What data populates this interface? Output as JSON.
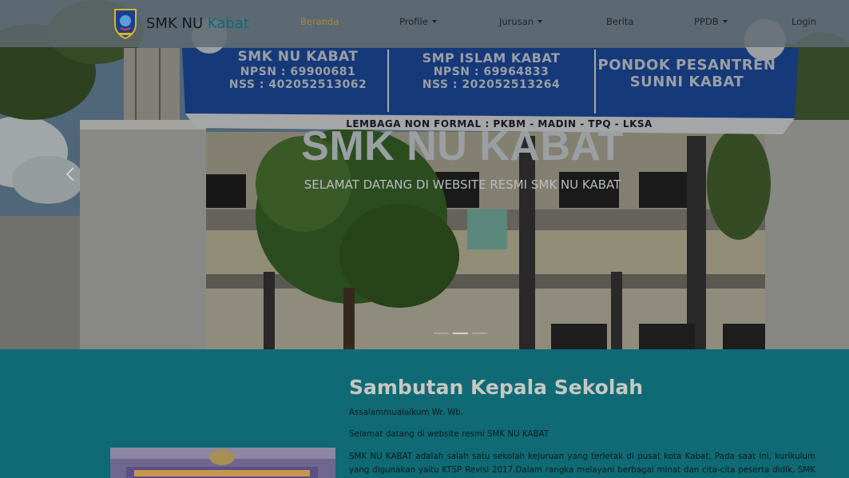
{
  "navbar": {
    "brand": {
      "name_main": "SMK NU",
      "name_accent": "Kabat",
      "logo": "school-crest-logo"
    },
    "items": [
      {
        "label": "Beranda",
        "active": true,
        "dropdown": false
      },
      {
        "label": "Profile",
        "active": false,
        "dropdown": true
      },
      {
        "label": "Jurusan",
        "active": false,
        "dropdown": true
      },
      {
        "label": "Berita",
        "active": false,
        "dropdown": false
      },
      {
        "label": "PPDB",
        "active": false,
        "dropdown": true
      },
      {
        "label": "Login",
        "active": false,
        "dropdown": false
      }
    ]
  },
  "hero": {
    "title": "SMK NU KABAT",
    "subtitle": "SELAMAT DATANG DI WEBSITE RESMI SMK NU KABAT",
    "banner": {
      "left": [
        "SMK NU KABAT",
        "NPSN : 69900681",
        "NSS : 402052513062"
      ],
      "middle": [
        "SMP ISLAM KABAT",
        "NPSN : 69964833",
        "NSS : 202052513264"
      ],
      "right": [
        "PONDOK PESANTREN",
        "SUNNI KABAT"
      ],
      "bottom": "LEMBAGA NON FORMAL : PKBM - MADIN - TPQ - LKSA"
    },
    "prev_icon": "chevron-left-icon",
    "slides": 3,
    "active_slide": 2
  },
  "welcome": {
    "title": "Sambutan Kepala Sekolah",
    "greeting": "Assalammualaikum Wr. Wb.",
    "intro": "Selamat datang di website resmi SMK NU KABAT",
    "body": "SMK NU KABAT adalah salah satu sekolah kejuruan yang terletak di pusat kota Kabat. Pada saat ini, kurikulum yang digunakan yaitu KTSP Revisi 2017.Dalam rangka melayani berbagai minat dan cita-cita peserta didik, SMK NU KABAT"
  },
  "colors": {
    "accent": "#0f6a75",
    "active_nav": "#a7883a"
  }
}
